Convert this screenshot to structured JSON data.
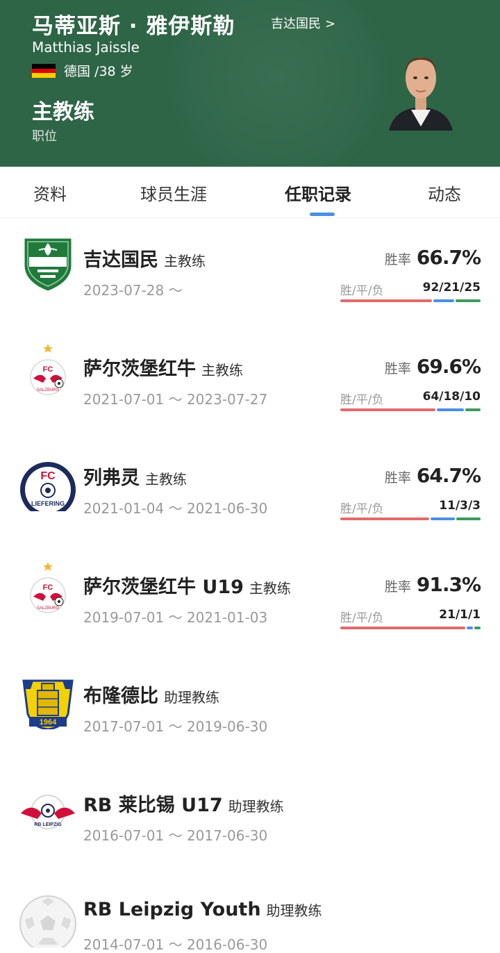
{
  "header": {
    "name_cn": "马蒂亚斯 · 雅伊斯勒",
    "club_link": "吉达国民",
    "club_link_chevron": ">",
    "name_en": "Matthias Jaissle",
    "nationality_age": "德国 /38 岁",
    "role": "主教练",
    "role_label": "职位",
    "bg_color": "#2e6547"
  },
  "tabs": [
    {
      "label": "资料",
      "active": false
    },
    {
      "label": "球员生涯",
      "active": false
    },
    {
      "label": "任职记录",
      "active": true
    },
    {
      "label": "动态",
      "active": false
    }
  ],
  "colors": {
    "win": "#e26a6a",
    "draw": "#4a90e2",
    "loss": "#3e9a5c",
    "accent": "#4a90e2"
  },
  "records": [
    {
      "club": "吉达国民",
      "role": "主教练",
      "period": "2023-07-28 ～",
      "logo_icon": "al-ahli-crest-icon",
      "win_rate_label": "胜率",
      "win_rate": "66.7%",
      "wdl_label": "胜/平/负",
      "wdl": "92/21/25",
      "w": 92,
      "d": 21,
      "l": 25
    },
    {
      "club": "萨尔茨堡红牛",
      "role": "主教练",
      "period": "2021-07-01 ～ 2023-07-27",
      "logo_icon": "salzburg-crest-icon",
      "win_rate_label": "胜率",
      "win_rate": "69.6%",
      "wdl_label": "胜/平/负",
      "wdl": "64/18/10",
      "w": 64,
      "d": 18,
      "l": 10
    },
    {
      "club": "列弗灵",
      "role": "主教练",
      "period": "2021-01-04 ～ 2021-06-30",
      "logo_icon": "liefering-crest-icon",
      "win_rate_label": "胜率",
      "win_rate": "64.7%",
      "wdl_label": "胜/平/负",
      "wdl": "11/3/3",
      "w": 11,
      "d": 3,
      "l": 3
    },
    {
      "club": "萨尔茨堡红牛 U19",
      "role": "主教练",
      "period": "2019-07-01 ～ 2021-01-03",
      "logo_icon": "salzburg-crest-icon",
      "win_rate_label": "胜率",
      "win_rate": "91.3%",
      "wdl_label": "胜/平/负",
      "wdl": "21/1/1",
      "w": 21,
      "d": 1,
      "l": 1
    },
    {
      "club": "布隆德比",
      "role": "助理教练",
      "period": "2017-07-01 ～ 2019-06-30",
      "logo_icon": "brondby-crest-icon"
    },
    {
      "club": "RB 莱比锡 U17",
      "role": "助理教练",
      "period": "2016-07-01 ～ 2017-06-30",
      "logo_icon": "rb-leipzig-crest-icon"
    },
    {
      "club": "RB Leipzig Youth",
      "role": "助理教练",
      "period": "2014-07-01 ～ 2016-06-30",
      "logo_icon": "football-placeholder-icon"
    }
  ]
}
